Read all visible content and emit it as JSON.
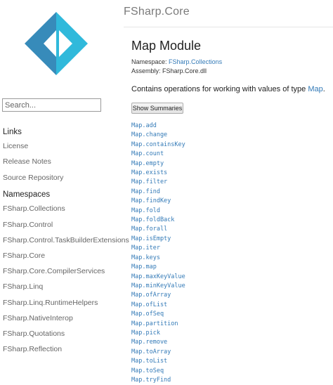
{
  "header": {
    "site_title": "FSharp.Core"
  },
  "logo": {
    "name": "fsharp-logo",
    "colors": {
      "light": "#30b9db",
      "dark": "#378bba"
    }
  },
  "search": {
    "placeholder": "Search..."
  },
  "sidebar": {
    "links_heading": "Links",
    "links": [
      "License",
      "Release Notes",
      "Source Repository"
    ],
    "namespaces_heading": "Namespaces",
    "namespaces": [
      "FSharp.Collections",
      "FSharp.Control",
      "FSharp.Control.TaskBuilderExtensions",
      "FSharp.Core",
      "FSharp.Core.CompilerServices",
      "FSharp.Linq",
      "FSharp.Linq.RuntimeHelpers",
      "FSharp.NativeInterop",
      "FSharp.Quotations",
      "FSharp.Reflection"
    ]
  },
  "main": {
    "title": "Map Module",
    "namespace_label": "Namespace:",
    "namespace_value": "FSharp.Collections",
    "assembly_label": "Assembly:",
    "assembly_value": "FSharp.Core.dll",
    "description_prefix": "Contains operations for working with values of type ",
    "description_link": "Map",
    "description_suffix": ".",
    "show_summaries_label": "Show Summaries",
    "members": [
      "Map.add",
      "Map.change",
      "Map.containsKey",
      "Map.count",
      "Map.empty",
      "Map.exists",
      "Map.filter",
      "Map.find",
      "Map.findKey",
      "Map.fold",
      "Map.foldBack",
      "Map.forall",
      "Map.isEmpty",
      "Map.iter",
      "Map.keys",
      "Map.map",
      "Map.maxKeyValue",
      "Map.minKeyValue",
      "Map.ofArray",
      "Map.ofList",
      "Map.ofSeq",
      "Map.partition",
      "Map.pick",
      "Map.remove",
      "Map.toArray",
      "Map.toList",
      "Map.toSeq",
      "Map.tryFind"
    ]
  },
  "colors": {
    "link": "#337ab7",
    "sidebar_link": "#666666",
    "heading": "#222222"
  }
}
